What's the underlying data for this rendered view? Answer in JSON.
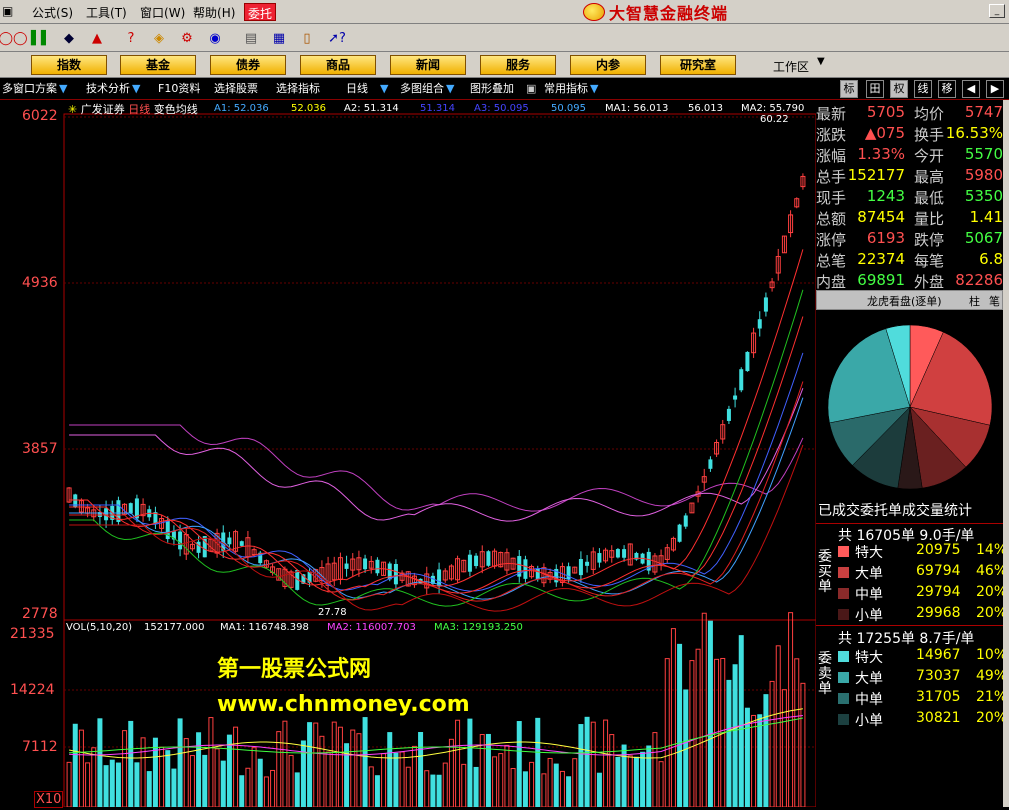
{
  "menu": [
    "公式",
    "工具",
    "窗口",
    "帮助"
  ],
  "menu_keys": [
    "(S)",
    "(T)",
    "(W)",
    "(H)"
  ],
  "entrust_label": "委托",
  "brand": "大智慧金融终端",
  "categories": [
    "指数",
    "基金",
    "债券",
    "商品",
    "新闻",
    "服务",
    "内参",
    "研究室"
  ],
  "workspace_label": "工作区",
  "funcbar": [
    "多窗口方案",
    "技术分析",
    "F10资料",
    "选择股票",
    "选择指标",
    "日线",
    "多图组合",
    "图形叠加",
    "常用指标"
  ],
  "right_tabs": [
    "标",
    "田",
    "权",
    "线",
    "移"
  ],
  "chart_header": {
    "stock": "广发证券",
    "period": "日线",
    "indicator": "变色均线",
    "a1": "A1: 52.036",
    "a1b": "52.036",
    "a2": "A2: 51.314",
    "a2b": "51.314",
    "a3": "A3: 50.095",
    "a3b": "50.095",
    "ma1": "MA1: 56.013",
    "ma1b": "56.013",
    "ma2": "MA2: 55.790"
  },
  "price_axis": [
    "6022",
    "4936",
    "3857",
    "2778"
  ],
  "price_high_label": "60.22",
  "price_low_label": "27.78",
  "vol_header": {
    "vol": "VOL(5,10,20)",
    "vol_value": "152177.000",
    "ma1": "MA1: 116748.398",
    "ma2": "MA2: 116007.703",
    "ma3": "MA3: 129193.250"
  },
  "vol_axis": [
    "21335",
    "14224",
    "7112"
  ],
  "vol_unit": "X10",
  "watermark": [
    "第一股票公式网",
    "www.chnmoney.com"
  ],
  "quote": [
    {
      "l1": "最新",
      "v1": "5705",
      "c1": "red",
      "l2": "均价",
      "v2": "5747",
      "c2": "red"
    },
    {
      "l1": "涨跌",
      "v1": "▲075",
      "c1": "red",
      "l2": "换手",
      "v2": "16.53%",
      "c2": "yel"
    },
    {
      "l1": "涨幅",
      "v1": "1.33%",
      "c1": "red",
      "l2": "今开",
      "v2": "5570",
      "c2": "grn"
    },
    {
      "l1": "总手",
      "v1": "152177",
      "c1": "yel",
      "l2": "最高",
      "v2": "5980",
      "c2": "red"
    },
    {
      "l1": "现手",
      "v1": "1243",
      "c1": "grn",
      "l2": "最低",
      "v2": "5350",
      "c2": "grn"
    },
    {
      "l1": "总额",
      "v1": "87454",
      "c1": "yel",
      "l2": "量比",
      "v2": "1.41",
      "c2": "yel"
    },
    {
      "l1": "涨停",
      "v1": "6193",
      "c1": "red",
      "l2": "跌停",
      "v2": "5067",
      "c2": "grn"
    },
    {
      "l1": "总笔",
      "v1": "22374",
      "c1": "yel",
      "l2": "每笔",
      "v2": "6.8",
      "c2": "yel"
    },
    {
      "l1": "内盘",
      "v1": "69891",
      "c1": "grn",
      "l2": "外盘",
      "v2": "82286",
      "c2": "red"
    }
  ],
  "longhu_tabs": [
    "龙虎看盘(逐单)",
    "柱",
    "笔"
  ],
  "pie": {
    "colors": [
      "#ff5a5a",
      "#d04040",
      "#a83030",
      "#6a2020",
      "#2a1818",
      "#1c3c3c",
      "#2a6a6a",
      "#3aa8a8",
      "#50dcdc"
    ],
    "values": [
      14,
      46,
      20,
      20,
      10,
      21,
      20,
      49,
      10
    ]
  },
  "stats_title": "已成交委托单成交量统计",
  "buy": {
    "header": "共 16705单 9.0手/单",
    "side": "委买单",
    "rows": [
      {
        "name": "特大",
        "value": "20975",
        "pct": "14%",
        "color": "#ff5a5a"
      },
      {
        "name": "大单",
        "value": "69794",
        "pct": "46%",
        "color": "#c84040"
      },
      {
        "name": "中单",
        "value": "29794",
        "pct": "20%",
        "color": "#8a2a2a"
      },
      {
        "name": "小单",
        "value": "29968",
        "pct": "20%",
        "color": "#4a1818"
      }
    ]
  },
  "sell": {
    "header": "共 17255单 8.7手/单",
    "side": "委卖单",
    "rows": [
      {
        "name": "特大",
        "value": "14967",
        "pct": "10%",
        "color": "#50dcdc"
      },
      {
        "name": "大单",
        "value": "73037",
        "pct": "49%",
        "color": "#3aa8a8"
      },
      {
        "name": "中单",
        "value": "31705",
        "pct": "21%",
        "color": "#2a7070"
      },
      {
        "name": "小单",
        "value": "30821",
        "pct": "20%",
        "color": "#1c4040"
      }
    ]
  }
}
